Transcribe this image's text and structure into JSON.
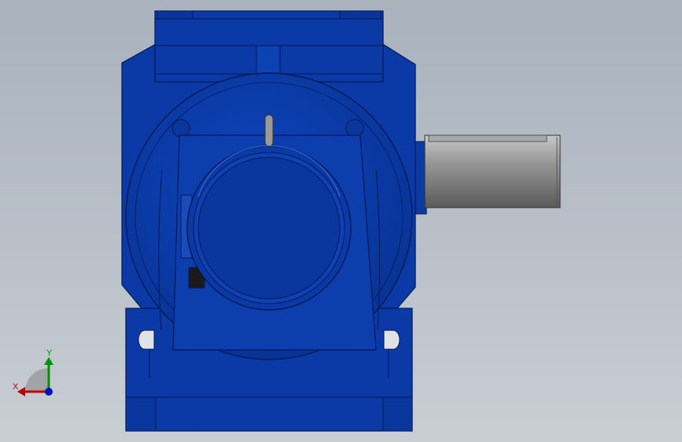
{
  "viewport": {
    "background_top": "#a9b2bd",
    "background_bottom": "#c9ced4"
  },
  "model": {
    "body_color": "#0b3aa6",
    "body_dark": "#062a80",
    "edge_color": "#021a55",
    "shaft_color": "#8c8c8c",
    "shaft_light": "#b4b4b4",
    "shaft_dark": "#5e5e5e"
  },
  "triad": {
    "x_label": "X",
    "y_label": "Y",
    "x_color": "#c00000",
    "y_color": "#009000",
    "z_color": "#0010c0"
  }
}
